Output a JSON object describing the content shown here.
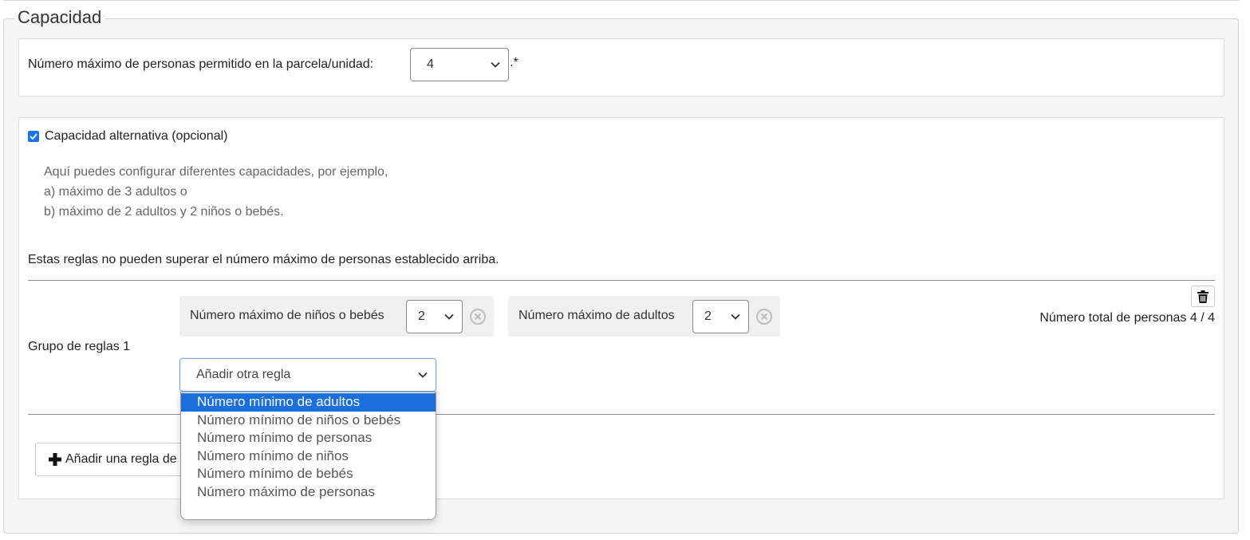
{
  "section": {
    "legend": "Capacidad"
  },
  "max_persons": {
    "label": "Número máximo de personas permitido en la parcela/unidad:",
    "value": "4",
    "suffix": ".*"
  },
  "alt_capacity": {
    "checkbox_label": "Capacidad alternativa (opcional)",
    "checked": true,
    "help_lines": [
      "Aquí puedes configurar diferentes capacidades, por ejemplo,",
      "a) máximo de 3 adultos o",
      "b) máximo de 2 adultos y 2 niños o bebés."
    ],
    "rules_note": "Estas reglas no pueden superar el número máximo de personas establecido arriba."
  },
  "rule_group": {
    "label": "Grupo de reglas 1",
    "rules": [
      {
        "label": "Número máximo de niños o bebés",
        "value": "2"
      },
      {
        "label": "Número máximo de adultos",
        "value": "2"
      }
    ],
    "total_label": "Número total de personas 4 / 4",
    "add_rule_placeholder": "Añadir otra regla"
  },
  "dropdown": {
    "options": [
      "Número mínimo de adultos",
      "Número mínimo de niños o bebés",
      "Número mínimo de personas",
      "Número mínimo de niños",
      "Número mínimo de bebés",
      "Número máximo de personas"
    ],
    "highlighted": "Número mínimo de adultos"
  },
  "add_group_button": {
    "label": "Añadir una regla de grupo"
  },
  "colors": {
    "accent": "#1a6fdc",
    "panel_bg": "#f5f5f5",
    "rule_bg": "#f0f0f0"
  },
  "icons": [
    "chevron-down-icon",
    "clear-circle-icon",
    "trash-icon",
    "plus-icon",
    "check-icon"
  ]
}
